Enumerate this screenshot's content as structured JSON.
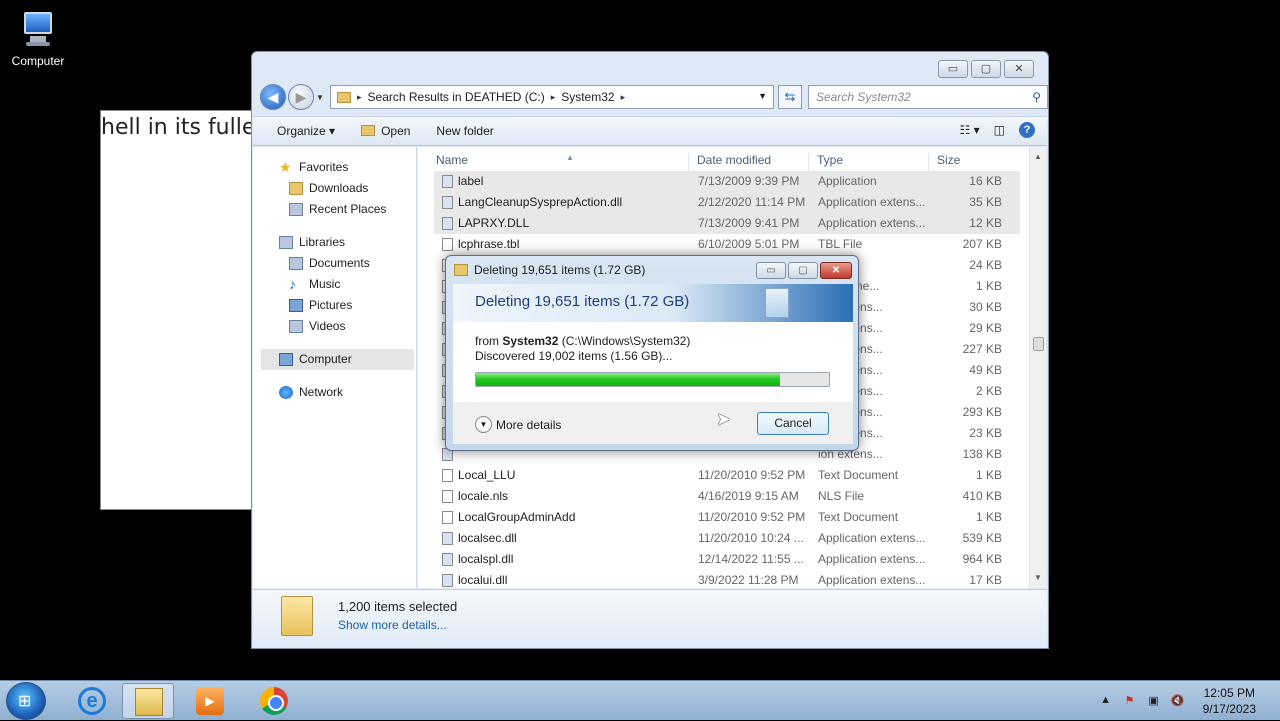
{
  "desktop": {
    "computer_label": "Computer"
  },
  "background_window": {
    "text": "hell in its fulles"
  },
  "explorer": {
    "caption_buttons": {
      "minimize": "▭",
      "maximize": "▢",
      "close": "✕"
    },
    "address": {
      "crumbs": [
        "Search Results in DEATHED (C:)",
        "System32"
      ],
      "separator": "▸"
    },
    "search_placeholder": "Search System32",
    "toolbar": {
      "organize": "Organize",
      "open": "Open",
      "new_folder": "New folder"
    },
    "nav": {
      "favorites": "Favorites",
      "downloads": "Downloads",
      "recent_places": "Recent Places",
      "libraries": "Libraries",
      "documents": "Documents",
      "music": "Music",
      "pictures": "Pictures",
      "videos": "Videos",
      "computer": "Computer",
      "network": "Network"
    },
    "columns": {
      "name": "Name",
      "date": "Date modified",
      "type": "Type",
      "size": "Size"
    },
    "files": [
      {
        "name": "label",
        "date": "7/13/2009 9:39 PM",
        "type": "Application",
        "size": "16 KB"
      },
      {
        "name": "LangCleanupSysprepAction.dll",
        "date": "2/12/2020 11:14 PM",
        "type": "Application extens...",
        "size": "35 KB"
      },
      {
        "name": "LAPRXY.DLL",
        "date": "7/13/2009 9:41 PM",
        "type": "Application extens...",
        "size": "12 KB"
      },
      {
        "name": "lcphrase.tbl",
        "date": "6/10/2009 5:01 PM",
        "type": "TBL File",
        "size": "207 KB"
      },
      {
        "name": "",
        "date": "",
        "type": "",
        "size": "24 KB"
      },
      {
        "name": "",
        "date": "",
        "type": "t Docume...",
        "size": "1 KB"
      },
      {
        "name": "",
        "date": "",
        "type": "ion extens...",
        "size": "30 KB"
      },
      {
        "name": "",
        "date": "",
        "type": "ion extens...",
        "size": "29 KB"
      },
      {
        "name": "",
        "date": "",
        "type": "ion extens...",
        "size": "227 KB"
      },
      {
        "name": "",
        "date": "",
        "type": "ion extens...",
        "size": "49 KB"
      },
      {
        "name": "",
        "date": "",
        "type": "ion extens...",
        "size": "2 KB"
      },
      {
        "name": "",
        "date": "",
        "type": "ion extens...",
        "size": "293 KB"
      },
      {
        "name": "",
        "date": "",
        "type": "ion extens...",
        "size": "23 KB"
      },
      {
        "name": "",
        "date": "",
        "type": "ion extens...",
        "size": "138 KB"
      },
      {
        "name": "Local_LLU",
        "date": "11/20/2010 9:52 PM",
        "type": "Text Document",
        "size": "1 KB"
      },
      {
        "name": "locale.nls",
        "date": "4/16/2019 9:15 AM",
        "type": "NLS File",
        "size": "410 KB"
      },
      {
        "name": "LocalGroupAdminAdd",
        "date": "11/20/2010 9:52 PM",
        "type": "Text Document",
        "size": "1 KB"
      },
      {
        "name": "localsec.dll",
        "date": "11/20/2010 10:24 ...",
        "type": "Application extens...",
        "size": "539 KB"
      },
      {
        "name": "localspl.dll",
        "date": "12/14/2022 11:55 ...",
        "type": "Application extens...",
        "size": "964 KB"
      },
      {
        "name": "localui.dll",
        "date": "3/9/2022 11:28 PM",
        "type": "Application extens...",
        "size": "17 KB"
      }
    ],
    "details": {
      "count": "1,200 items selected",
      "more": "Show more details..."
    }
  },
  "dialog": {
    "title": "Deleting 19,651 items (1.72 GB)",
    "heading": "Deleting 19,651 items (1.72 GB)",
    "from_prefix": "from",
    "from_folder": "System32",
    "from_path": "(C:\\Windows\\System32)",
    "discovered": "Discovered 19,002 items (1.56 GB)...",
    "progress": 0.86,
    "more_details": "More details",
    "cancel": "Cancel",
    "progress_color": "#1ec71a"
  },
  "taskbar": {
    "time": "12:05 PM",
    "date": "9/17/2023",
    "apps": [
      "internet-explorer",
      "windows-explorer",
      "media-player",
      "chrome"
    ]
  }
}
